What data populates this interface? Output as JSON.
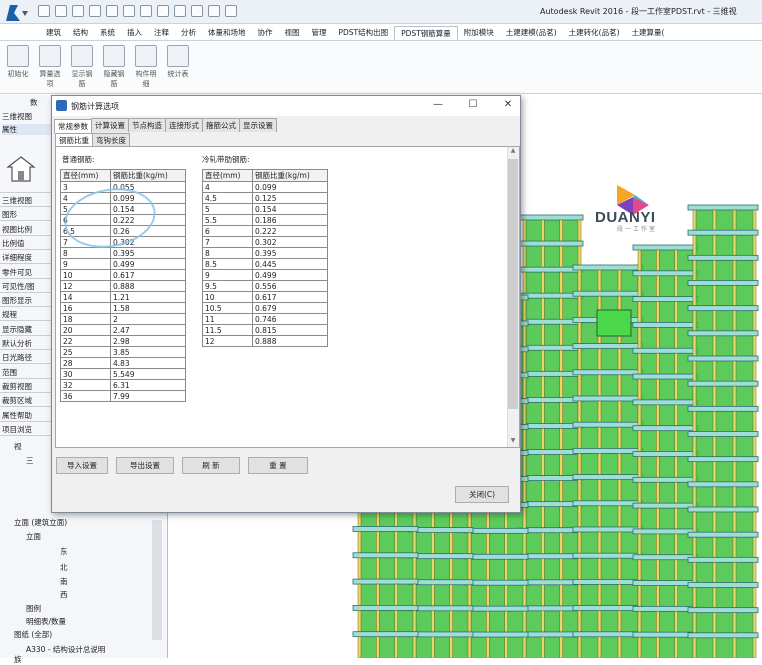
{
  "app": {
    "title": "Autodesk Revit 2016 -    段一工作室PDST.rvt - 三维视",
    "ribbon_tabs": [
      "建筑",
      "结构",
      "系统",
      "插入",
      "注释",
      "分析",
      "体量和场地",
      "协作",
      "视图",
      "管理",
      "PDST结构出图",
      "PDST钢筋算量",
      "附加模块",
      "土建建模(品茗)",
      "土建转化(品茗)",
      "土建算量("
    ],
    "active_ribbon_tab": "PDST钢筋算量",
    "ribbon_buttons": [
      {
        "label": "初始化",
        "icon": "init-icon"
      },
      {
        "label": "算量选项",
        "icon": "gear-icon"
      },
      {
        "label": "显示钢筋",
        "icon": "show-rebar-icon"
      },
      {
        "label": "隐藏钢筋",
        "icon": "hide-rebar-icon"
      },
      {
        "label": "构件明细",
        "icon": "component-icon"
      },
      {
        "label": "统计表",
        "icon": "table-icon"
      }
    ]
  },
  "left_panel": {
    "panel_tabs": [
      "数",
      "三维视图",
      "属性"
    ],
    "rows": [
      "三维视图",
      "图形",
      "视图比例",
      "比例值",
      "详细程度",
      "零件可见",
      "可见性/图",
      "图形显示",
      "规程",
      "显示隐藏",
      "默认分析",
      "日光路径",
      "范围",
      "裁剪视图",
      "裁剪区域",
      "属性帮助",
      "项目浏览"
    ],
    "tree": [
      "视",
      "三",
      "立面 (建筑立面)",
      "立面",
      "东",
      "北",
      "南",
      "西",
      "图例",
      "明细表/数量",
      "图纸 (全部)",
      "A330 - 结构设计总说明",
      "族"
    ]
  },
  "brand": {
    "name": "DUANYI",
    "sub": "段一工作室"
  },
  "dialog": {
    "title": "钢筋计算选项",
    "tabs": [
      "常规参数",
      "计算设置",
      "节点构造",
      "连接形式",
      "箍筋公式",
      "显示设置"
    ],
    "active_tab": "常规参数",
    "subtabs": [
      "钢筋比重",
      "弯钩长度"
    ],
    "active_subtab": "钢筋比重",
    "ordinary": {
      "label": "普通钢筋:",
      "headers": [
        "直径(mm)",
        "钢筋比重(kg/m)"
      ],
      "rows": [
        [
          "3",
          "0.055"
        ],
        [
          "4",
          "0.099"
        ],
        [
          "5",
          "0.154"
        ],
        [
          "6",
          "0.222"
        ],
        [
          "6.5",
          "0.26"
        ],
        [
          "7",
          "0.302"
        ],
        [
          "8",
          "0.395"
        ],
        [
          "9",
          "0.499"
        ],
        [
          "10",
          "0.617"
        ],
        [
          "12",
          "0.888"
        ],
        [
          "14",
          "1.21"
        ],
        [
          "16",
          "1.58"
        ],
        [
          "18",
          "2"
        ],
        [
          "20",
          "2.47"
        ],
        [
          "22",
          "2.98"
        ],
        [
          "25",
          "3.85"
        ],
        [
          "28",
          "4.83"
        ],
        [
          "30",
          "5.549"
        ],
        [
          "32",
          "6.31"
        ],
        [
          "36",
          "7.99"
        ]
      ]
    },
    "cold_rolled": {
      "label": "冷轧带肋钢筋:",
      "headers": [
        "直径(mm)",
        "钢筋比重(kg/m)"
      ],
      "rows": [
        [
          "4",
          "0.099"
        ],
        [
          "4.5",
          "0.125"
        ],
        [
          "5",
          "0.154"
        ],
        [
          "5.5",
          "0.186"
        ],
        [
          "6",
          "0.222"
        ],
        [
          "7",
          "0.302"
        ],
        [
          "8",
          "0.395"
        ],
        [
          "8.5",
          "0.445"
        ],
        [
          "9",
          "0.499"
        ],
        [
          "9.5",
          "0.556"
        ],
        [
          "10",
          "0.617"
        ],
        [
          "10.5",
          "0.679"
        ],
        [
          "11",
          "0.746"
        ],
        [
          "11.5",
          "0.815"
        ],
        [
          "12",
          "0.888"
        ]
      ]
    },
    "buttons": {
      "import": "导入设置",
      "export": "导出设置",
      "refresh": "刷  新",
      "reset": "重  置",
      "close": "关闭(C)"
    },
    "window_controls": {
      "minimize": "—",
      "maximize": "☐",
      "close": "✕"
    }
  }
}
